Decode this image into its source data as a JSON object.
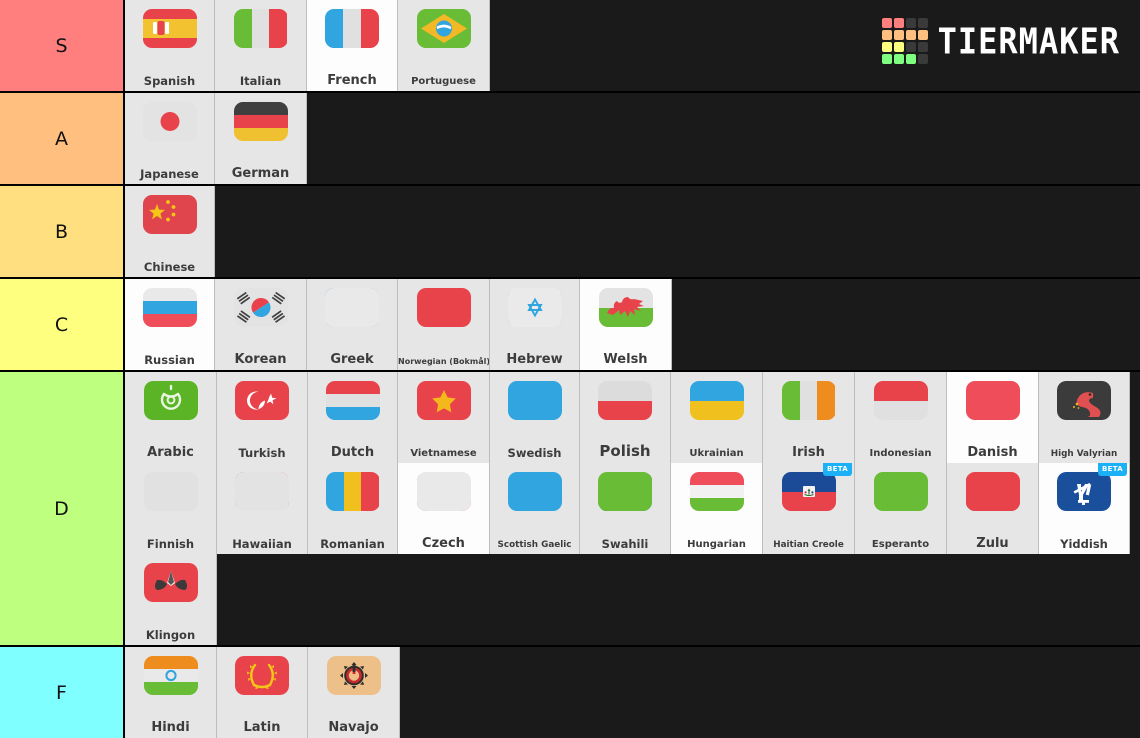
{
  "logo": {
    "wordmark": "TIERMAKER",
    "grid_colors": [
      [
        "#ff7f7f",
        "#ff7f7f",
        "#3a3a3a",
        "#3a3a3a"
      ],
      [
        "#ffbf7f",
        "#ffbf7f",
        "#ffbf7f",
        "#ffbf7f"
      ],
      [
        "#ffff7f",
        "#ffff7f",
        "#3a3a3a",
        "#3a3a3a"
      ],
      [
        "#7fff7f",
        "#7fff7f",
        "#7fff7f",
        "#3a3a3a"
      ]
    ]
  },
  "tiers": [
    {
      "label": "S",
      "color": "#ff7f7f",
      "items": [
        {
          "name": "Spanish",
          "flag": "spain",
          "width": 90,
          "alt": false,
          "beta": null
        },
        {
          "name": "Italian",
          "flag": "italy",
          "width": 92,
          "alt": false,
          "beta": null
        },
        {
          "name": "French",
          "flag": "france",
          "width": 91,
          "alt": true,
          "beta": null
        },
        {
          "name": "Portuguese",
          "flag": "brazil",
          "width": 92,
          "alt": false,
          "beta": null
        }
      ]
    },
    {
      "label": "A",
      "color": "#ffbf7f",
      "items": [
        {
          "name": "Japanese",
          "flag": "japan",
          "width": 90,
          "alt": false,
          "beta": null
        },
        {
          "name": "German",
          "flag": "germany",
          "width": 92,
          "alt": false,
          "beta": null
        }
      ]
    },
    {
      "label": "B",
      "color": "#ffdf7f",
      "items": [
        {
          "name": "Chinese",
          "flag": "china",
          "width": 90,
          "alt": false,
          "beta": null
        }
      ]
    },
    {
      "label": "C",
      "color": "#ffff7f",
      "items": [
        {
          "name": "Russian",
          "flag": "russia",
          "width": 90,
          "alt": true,
          "beta": null
        },
        {
          "name": "Korean",
          "flag": "korea",
          "width": 92,
          "alt": false,
          "beta": null
        },
        {
          "name": "Greek",
          "flag": "greece",
          "width": 91,
          "alt": false,
          "beta": null
        },
        {
          "name": "Norwegian (Bokmål)",
          "flag": "norway",
          "width": 92,
          "alt": false,
          "beta": null
        },
        {
          "name": "Hebrew",
          "flag": "israel",
          "width": 90,
          "alt": false,
          "beta": null
        },
        {
          "name": "Welsh",
          "flag": "wales",
          "width": 92,
          "alt": true,
          "beta": null
        }
      ]
    },
    {
      "label": "D",
      "color": "#bfff7f",
      "items": [
        {
          "name": "Arabic",
          "flag": "arabic",
          "width": 92,
          "alt": false,
          "beta": null
        },
        {
          "name": "Turkish",
          "flag": "turkey",
          "width": 91,
          "alt": false,
          "beta": null
        },
        {
          "name": "Dutch",
          "flag": "netherlands",
          "width": 90,
          "alt": false,
          "beta": null
        },
        {
          "name": "Vietnamese",
          "flag": "vietnam",
          "width": 92,
          "alt": false,
          "beta": null
        },
        {
          "name": "Swedish",
          "flag": "sweden",
          "width": 90,
          "alt": false,
          "beta": null
        },
        {
          "name": "Polish",
          "flag": "poland",
          "width": 91,
          "alt": false,
          "beta": null
        },
        {
          "name": "Ukrainian",
          "flag": "ukraine",
          "width": 92,
          "alt": false,
          "beta": null
        },
        {
          "name": "Irish",
          "flag": "ireland",
          "width": 92,
          "alt": false,
          "beta": null
        },
        {
          "name": "Indonesian",
          "flag": "indonesia",
          "width": 92,
          "alt": false,
          "beta": null
        },
        {
          "name": "Danish",
          "flag": "denmark",
          "width": 92,
          "alt": true,
          "beta": null
        },
        {
          "name": "High Valyrian",
          "flag": "valyrian",
          "width": 91,
          "alt": false,
          "beta": null
        },
        {
          "name": "Finnish",
          "flag": "finland",
          "width": 92,
          "alt": false,
          "beta": null
        },
        {
          "name": "Hawaiian",
          "flag": "hawaii",
          "width": 91,
          "alt": false,
          "beta": null
        },
        {
          "name": "Romanian",
          "flag": "romania",
          "width": 90,
          "alt": false,
          "beta": null
        },
        {
          "name": "Czech",
          "flag": "czech",
          "width": 92,
          "alt": true,
          "beta": null
        },
        {
          "name": "Scottish Gaelic",
          "flag": "scotland",
          "width": 90,
          "alt": false,
          "beta": null
        },
        {
          "name": "Swahili",
          "flag": "tanzania",
          "width": 91,
          "alt": false,
          "beta": null
        },
        {
          "name": "Hungarian",
          "flag": "hungary",
          "width": 92,
          "alt": true,
          "beta": null
        },
        {
          "name": "Haitian Creole",
          "flag": "haiti",
          "width": 92,
          "alt": false,
          "beta": "BETA"
        },
        {
          "name": "Esperanto",
          "flag": "esperanto",
          "width": 92,
          "alt": false,
          "beta": null
        },
        {
          "name": "Zulu",
          "flag": "southafrica",
          "width": 92,
          "alt": false,
          "beta": null
        },
        {
          "name": "Yiddish",
          "flag": "yiddish",
          "width": 91,
          "alt": true,
          "beta": "BETA"
        },
        {
          "name": "Klingon",
          "flag": "klingon",
          "width": 92,
          "alt": false,
          "beta": null
        }
      ]
    },
    {
      "label": "F",
      "color": "#7fffff",
      "items": [
        {
          "name": "Hindi",
          "flag": "india",
          "width": 92,
          "alt": false,
          "beta": null
        },
        {
          "name": "Latin",
          "flag": "latin",
          "width": 91,
          "alt": false,
          "beta": null
        },
        {
          "name": "Navajo",
          "flag": "navajo",
          "width": 92,
          "alt": false,
          "beta": null
        }
      ]
    }
  ]
}
